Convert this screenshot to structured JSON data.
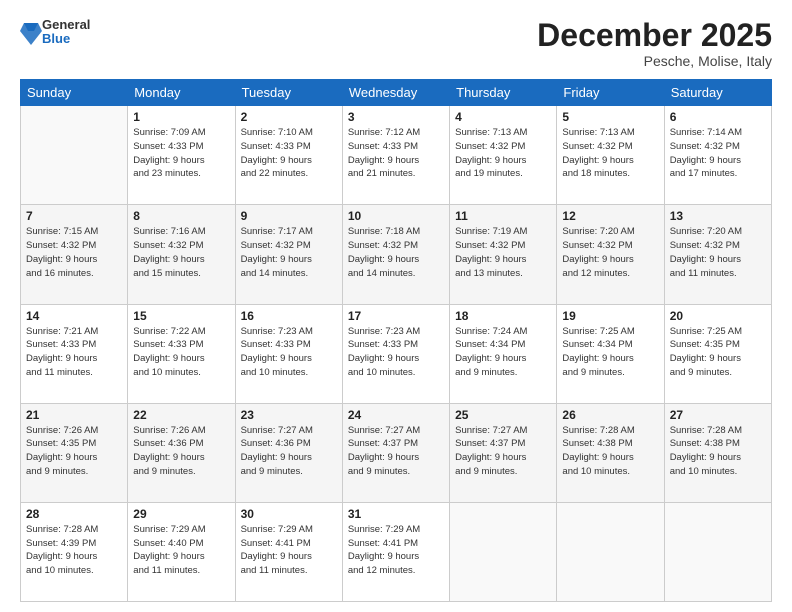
{
  "header": {
    "logo_general": "General",
    "logo_blue": "Blue",
    "month_title": "December 2025",
    "location": "Pesche, Molise, Italy"
  },
  "days_of_week": [
    "Sunday",
    "Monday",
    "Tuesday",
    "Wednesday",
    "Thursday",
    "Friday",
    "Saturday"
  ],
  "weeks": [
    [
      {
        "num": "",
        "info": ""
      },
      {
        "num": "1",
        "info": "Sunrise: 7:09 AM\nSunset: 4:33 PM\nDaylight: 9 hours\nand 23 minutes."
      },
      {
        "num": "2",
        "info": "Sunrise: 7:10 AM\nSunset: 4:33 PM\nDaylight: 9 hours\nand 22 minutes."
      },
      {
        "num": "3",
        "info": "Sunrise: 7:12 AM\nSunset: 4:33 PM\nDaylight: 9 hours\nand 21 minutes."
      },
      {
        "num": "4",
        "info": "Sunrise: 7:13 AM\nSunset: 4:32 PM\nDaylight: 9 hours\nand 19 minutes."
      },
      {
        "num": "5",
        "info": "Sunrise: 7:13 AM\nSunset: 4:32 PM\nDaylight: 9 hours\nand 18 minutes."
      },
      {
        "num": "6",
        "info": "Sunrise: 7:14 AM\nSunset: 4:32 PM\nDaylight: 9 hours\nand 17 minutes."
      }
    ],
    [
      {
        "num": "7",
        "info": "Sunrise: 7:15 AM\nSunset: 4:32 PM\nDaylight: 9 hours\nand 16 minutes."
      },
      {
        "num": "8",
        "info": "Sunrise: 7:16 AM\nSunset: 4:32 PM\nDaylight: 9 hours\nand 15 minutes."
      },
      {
        "num": "9",
        "info": "Sunrise: 7:17 AM\nSunset: 4:32 PM\nDaylight: 9 hours\nand 14 minutes."
      },
      {
        "num": "10",
        "info": "Sunrise: 7:18 AM\nSunset: 4:32 PM\nDaylight: 9 hours\nand 14 minutes."
      },
      {
        "num": "11",
        "info": "Sunrise: 7:19 AM\nSunset: 4:32 PM\nDaylight: 9 hours\nand 13 minutes."
      },
      {
        "num": "12",
        "info": "Sunrise: 7:20 AM\nSunset: 4:32 PM\nDaylight: 9 hours\nand 12 minutes."
      },
      {
        "num": "13",
        "info": "Sunrise: 7:20 AM\nSunset: 4:32 PM\nDaylight: 9 hours\nand 11 minutes."
      }
    ],
    [
      {
        "num": "14",
        "info": "Sunrise: 7:21 AM\nSunset: 4:33 PM\nDaylight: 9 hours\nand 11 minutes."
      },
      {
        "num": "15",
        "info": "Sunrise: 7:22 AM\nSunset: 4:33 PM\nDaylight: 9 hours\nand 10 minutes."
      },
      {
        "num": "16",
        "info": "Sunrise: 7:23 AM\nSunset: 4:33 PM\nDaylight: 9 hours\nand 10 minutes."
      },
      {
        "num": "17",
        "info": "Sunrise: 7:23 AM\nSunset: 4:33 PM\nDaylight: 9 hours\nand 10 minutes."
      },
      {
        "num": "18",
        "info": "Sunrise: 7:24 AM\nSunset: 4:34 PM\nDaylight: 9 hours\nand 9 minutes."
      },
      {
        "num": "19",
        "info": "Sunrise: 7:25 AM\nSunset: 4:34 PM\nDaylight: 9 hours\nand 9 minutes."
      },
      {
        "num": "20",
        "info": "Sunrise: 7:25 AM\nSunset: 4:35 PM\nDaylight: 9 hours\nand 9 minutes."
      }
    ],
    [
      {
        "num": "21",
        "info": "Sunrise: 7:26 AM\nSunset: 4:35 PM\nDaylight: 9 hours\nand 9 minutes."
      },
      {
        "num": "22",
        "info": "Sunrise: 7:26 AM\nSunset: 4:36 PM\nDaylight: 9 hours\nand 9 minutes."
      },
      {
        "num": "23",
        "info": "Sunrise: 7:27 AM\nSunset: 4:36 PM\nDaylight: 9 hours\nand 9 minutes."
      },
      {
        "num": "24",
        "info": "Sunrise: 7:27 AM\nSunset: 4:37 PM\nDaylight: 9 hours\nand 9 minutes."
      },
      {
        "num": "25",
        "info": "Sunrise: 7:27 AM\nSunset: 4:37 PM\nDaylight: 9 hours\nand 9 minutes."
      },
      {
        "num": "26",
        "info": "Sunrise: 7:28 AM\nSunset: 4:38 PM\nDaylight: 9 hours\nand 10 minutes."
      },
      {
        "num": "27",
        "info": "Sunrise: 7:28 AM\nSunset: 4:38 PM\nDaylight: 9 hours\nand 10 minutes."
      }
    ],
    [
      {
        "num": "28",
        "info": "Sunrise: 7:28 AM\nSunset: 4:39 PM\nDaylight: 9 hours\nand 10 minutes."
      },
      {
        "num": "29",
        "info": "Sunrise: 7:29 AM\nSunset: 4:40 PM\nDaylight: 9 hours\nand 11 minutes."
      },
      {
        "num": "30",
        "info": "Sunrise: 7:29 AM\nSunset: 4:41 PM\nDaylight: 9 hours\nand 11 minutes."
      },
      {
        "num": "31",
        "info": "Sunrise: 7:29 AM\nSunset: 4:41 PM\nDaylight: 9 hours\nand 12 minutes."
      },
      {
        "num": "",
        "info": ""
      },
      {
        "num": "",
        "info": ""
      },
      {
        "num": "",
        "info": ""
      }
    ]
  ]
}
